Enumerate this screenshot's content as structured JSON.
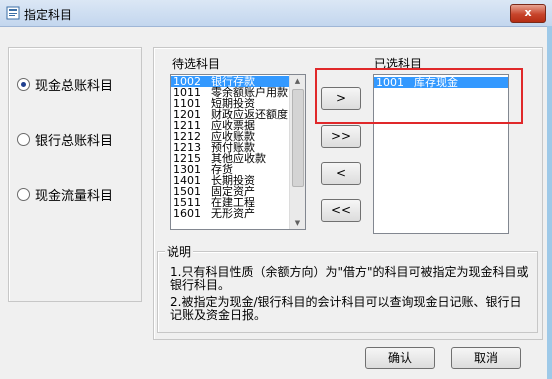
{
  "window": {
    "title": "指定科目",
    "close_label": "x"
  },
  "radios": [
    {
      "label": "现金总账科目",
      "checked": true
    },
    {
      "label": "银行总账科目",
      "checked": false
    },
    {
      "label": "现金流量科目",
      "checked": false
    }
  ],
  "candidates": {
    "label": "待选科目",
    "items": [
      {
        "code": "1002",
        "name": "银行存款",
        "selected": true
      },
      {
        "code": "1011",
        "name": "零余额账户用款"
      },
      {
        "code": "1101",
        "name": "短期投资"
      },
      {
        "code": "1201",
        "name": "财政应返还额度"
      },
      {
        "code": "1211",
        "name": "应收票据"
      },
      {
        "code": "1212",
        "name": "应收账款"
      },
      {
        "code": "1213",
        "name": "预付账款"
      },
      {
        "code": "1215",
        "name": "其他应收款"
      },
      {
        "code": "1301",
        "name": "存货"
      },
      {
        "code": "1401",
        "name": "长期投资"
      },
      {
        "code": "1501",
        "name": "固定资产"
      },
      {
        "code": "1511",
        "name": "在建工程"
      },
      {
        "code": "1601",
        "name": "无形资产"
      }
    ]
  },
  "selected": {
    "label": "已选科目",
    "items": [
      {
        "code": "1001",
        "name": "库存现金",
        "selected": true
      }
    ]
  },
  "transfer_buttons": {
    "add_one": ">",
    "add_all": ">>",
    "remove_one": "<",
    "remove_all": "<<"
  },
  "explanation": {
    "title": "说明",
    "line1": "1.只有科目性质（余额方向）为\"借方\"的科目可被指定为现金科目或银行科目。",
    "line2": "2.被指定为现金/银行科目的会计科目可以查询现金日记账、银行日记账及资金日报。"
  },
  "footer": {
    "ok_label": "确认",
    "cancel_label": "取消"
  }
}
